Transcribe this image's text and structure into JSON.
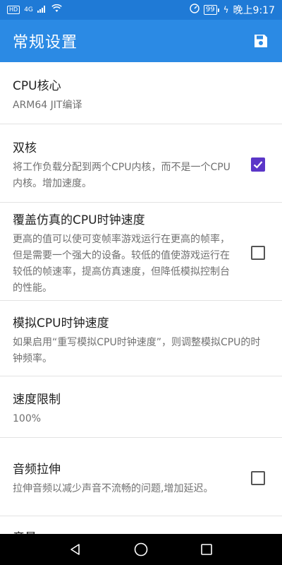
{
  "status_bar": {
    "hd": "HD",
    "network": "4G",
    "battery": "99",
    "time": "晚上9:17"
  },
  "app_bar": {
    "title": "常规设置",
    "save_icon": "save-icon"
  },
  "preferences": [
    {
      "title": "CPU核心",
      "summary": "ARM64 JIT编译",
      "checkbox": null
    },
    {
      "title": "双核",
      "summary": "将工作负载分配到两个CPU内核，而不是一个CPU内核。增加速度。",
      "checkbox": true
    },
    {
      "title": "覆盖仿真的CPU时钟速度",
      "summary": "更高的值可以使可变帧率游戏运行在更高的帧率，但是需要一个强大的设备。较低的值使游戏运行在较低的帧速率，提高仿真速度，但降低模拟控制台的性能。",
      "checkbox": false
    },
    {
      "title": "模拟CPU时钟速度",
      "summary": "如果启用“重写模拟CPU时钟速度”，则调整模拟CPU的时钟频率。",
      "checkbox": null
    },
    {
      "title": "速度限制",
      "summary": "100%",
      "checkbox": null
    },
    {
      "title": "音频拉伸",
      "summary": "拉伸音频以减少声音不流畅的问题,增加延迟。",
      "checkbox": false
    },
    {
      "title": "音量",
      "summary": "",
      "checkbox": null
    }
  ],
  "colors": {
    "status_bar": "#1f7ad6",
    "app_bar": "#2b8ae4",
    "checkbox_checked": "#5b36c8"
  },
  "nav": {
    "back_icon": "back-triangle-icon",
    "home_icon": "home-circle-icon",
    "recents_icon": "recents-square-icon"
  }
}
